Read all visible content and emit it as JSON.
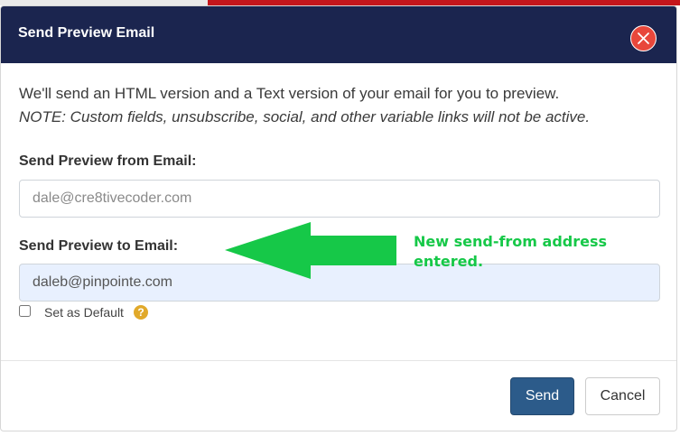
{
  "dialog": {
    "title": "Send Preview Email",
    "intro": "We'll send an HTML version and a Text version of your email for you to preview.",
    "note": "NOTE: Custom fields, unsubscribe, social, and other variable links will not be active."
  },
  "from_field": {
    "label": "Send Preview from Email:",
    "placeholder": "dale@cre8tivecoder.com"
  },
  "to_field": {
    "label": "Send Preview to Email:",
    "value": "daleb@pinpointe.com"
  },
  "default_checkbox": {
    "label": "Set as Default",
    "checked": false,
    "help_icon": "question-circle-icon"
  },
  "buttons": {
    "send": "Send",
    "cancel": "Cancel"
  },
  "annotation": {
    "line1": "New send-from address",
    "line2": "entered.",
    "color": "#16c848"
  },
  "colors": {
    "header": "#1b254f",
    "close_button": "#e8473b",
    "send_button": "#2c5b8a",
    "autofill_input": "#e8f0fe"
  }
}
